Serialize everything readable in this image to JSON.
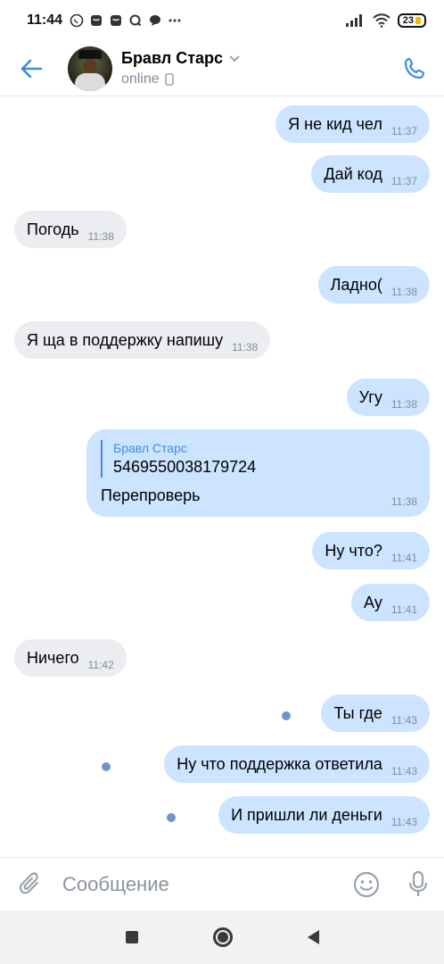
{
  "status_bar": {
    "time": "11:44",
    "battery": "23",
    "left_icons": [
      "whatsapp-icon",
      "bag-icon",
      "bag-icon",
      "search-q-icon",
      "chat-icon",
      "more-dots-icon"
    ],
    "right_icons": [
      "signal-icon",
      "wifi-icon",
      "battery-icon"
    ]
  },
  "header": {
    "name": "Бравл Старс",
    "status": "online",
    "back_icon": "back-arrow-icon",
    "call_icon": "phone-icon",
    "dropdown_icon": "chevron-down-icon",
    "device_icon": "mobile-icon"
  },
  "messages": [
    {
      "dir": "out",
      "text": "Я не кид чел",
      "time": "11:37"
    },
    {
      "dir": "out",
      "text": "Дай код",
      "time": "11:37"
    },
    {
      "dir": "in",
      "text": "Погодь",
      "time": "11:38"
    },
    {
      "dir": "out",
      "text": "Ладно(",
      "time": "11:38"
    },
    {
      "dir": "in",
      "text": "Я ща в поддержку напишу",
      "time": "11:38"
    },
    {
      "dir": "out",
      "text": "Угу",
      "time": "11:38"
    },
    {
      "dir": "out",
      "reply_author": "Бравл Старс",
      "reply_text": "5469550038179724",
      "text": "Перепроверь",
      "time": "11:38"
    },
    {
      "dir": "out",
      "text": "Ну что?",
      "time": "11:41"
    },
    {
      "dir": "out",
      "text": "Ау",
      "time": "11:41"
    },
    {
      "dir": "in",
      "text": "Ничего",
      "time": "11:42"
    },
    {
      "dir": "out",
      "text": "Ты где",
      "time": "11:43",
      "unread": true
    },
    {
      "dir": "out",
      "text": "Ну что поддержка ответила",
      "time": "11:43",
      "unread": true
    },
    {
      "dir": "out",
      "text": "И пришли ли деньги",
      "time": "11:43",
      "unread": true
    }
  ],
  "composer": {
    "placeholder": "Сообщение",
    "attach_icon": "paperclip-icon",
    "emoji_icon": "smile-icon",
    "mic_icon": "microphone-icon"
  },
  "colors": {
    "accent": "#3f8ae0",
    "outgoing_bubble": "#cce4ff",
    "incoming_bubble": "#ebedf0",
    "unread_dot": "#6f95c5",
    "meta_text": "#818c99"
  },
  "navbar": {
    "icons": [
      "recents-square-icon",
      "home-circle-icon",
      "back-triangle-icon"
    ]
  }
}
